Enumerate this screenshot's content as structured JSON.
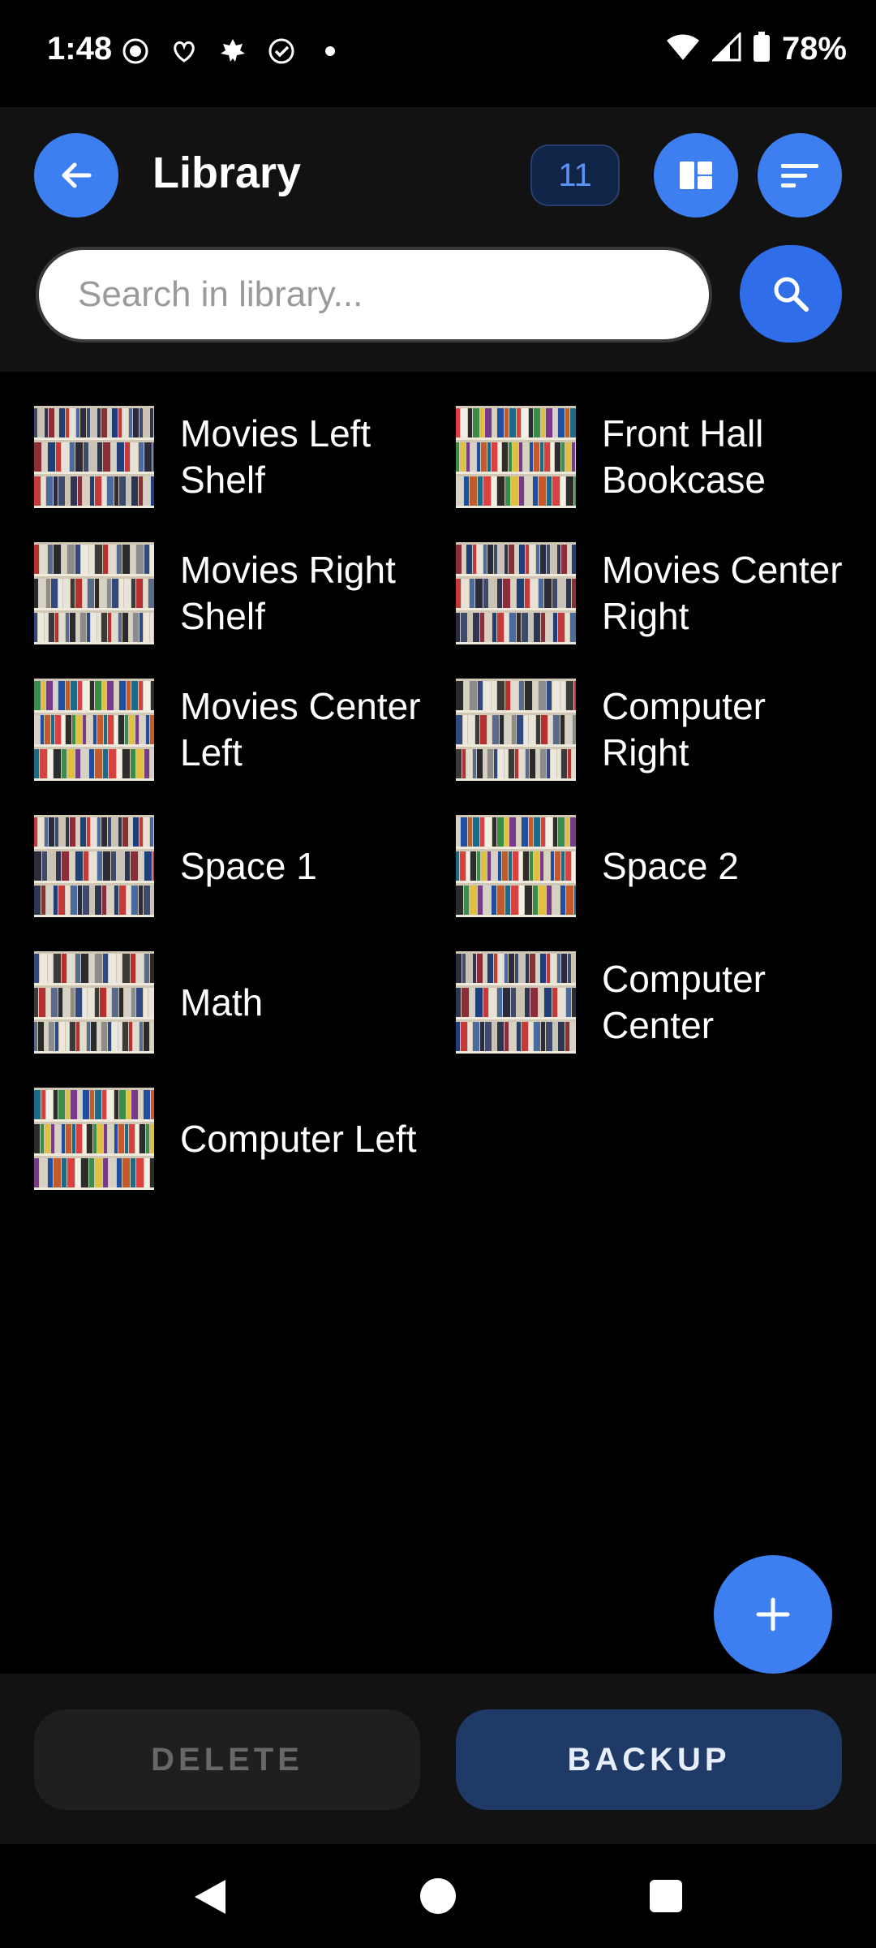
{
  "status_bar": {
    "time": "1:48",
    "battery": "78%",
    "icons": [
      "screen-record-icon",
      "app-icon",
      "maple-leaf-icon",
      "check-circle-icon",
      "dot-icon",
      "wifi-icon",
      "signal-icon",
      "battery-icon"
    ]
  },
  "header": {
    "title": "Library",
    "count": "11"
  },
  "search": {
    "placeholder": "Search in library..."
  },
  "items": [
    {
      "label": "Movies Left Shelf"
    },
    {
      "label": "Front Hall Bookcase"
    },
    {
      "label": "Movies Right Shelf"
    },
    {
      "label": "Movies Center Right"
    },
    {
      "label": "Movies Center Left"
    },
    {
      "label": "Computer Right"
    },
    {
      "label": "Space 1"
    },
    {
      "label": "Space 2"
    },
    {
      "label": "Math"
    },
    {
      "label": "Computer Center"
    },
    {
      "label": "Computer Left"
    }
  ],
  "actions": {
    "delete": "DELETE",
    "backup": "BACKUP"
  },
  "colors": {
    "accent": "#3d7ff0",
    "backup_bg": "#1f3a66",
    "header_bg": "#121212"
  }
}
